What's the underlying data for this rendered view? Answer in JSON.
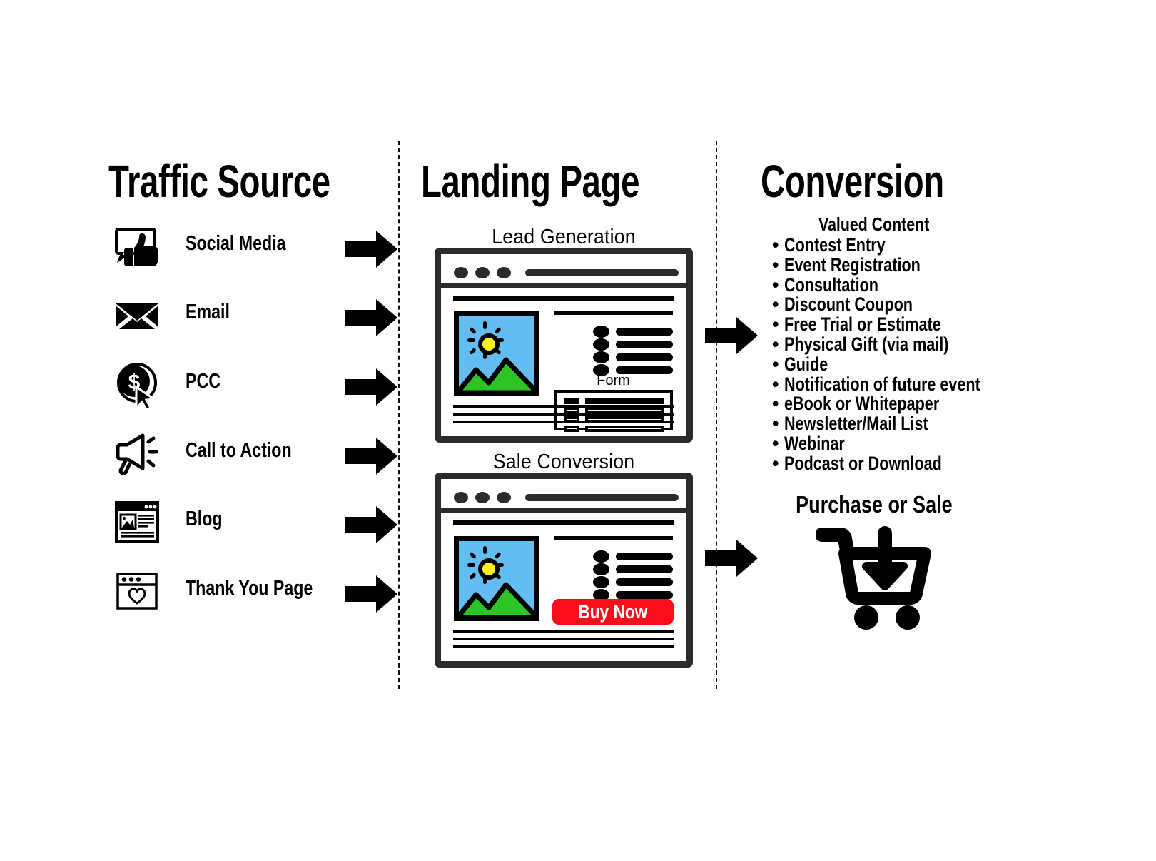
{
  "columns": {
    "traffic": {
      "title": "Traffic Source"
    },
    "landing": {
      "title": "Landing Page"
    },
    "conversion": {
      "title": "Conversion"
    }
  },
  "traffic_sources": [
    {
      "label": "Social Media",
      "icon": "thumbs-up-speech-bubble-icon"
    },
    {
      "label": "Email",
      "icon": "envelope-icon"
    },
    {
      "label": "PCC",
      "icon": "pay-per-click-cursor-icon"
    },
    {
      "label": "Call to Action",
      "icon": "megaphone-icon"
    },
    {
      "label": "Blog",
      "icon": "blog-article-window-icon"
    },
    {
      "label": "Thank You Page",
      "icon": "heart-window-icon"
    }
  ],
  "landing_pages": [
    {
      "caption": "Lead Generation",
      "form_label": "Form",
      "cta": null
    },
    {
      "caption": "Sale Conversion",
      "form_label": null,
      "cta": "Buy Now"
    }
  ],
  "conversion": {
    "valued_content_title": "Valued Content",
    "valued_content_items": [
      "Contest Entry",
      "Event Registration",
      "Consultation",
      "Discount Coupon",
      "Free Trial or Estimate",
      "Physical Gift (via mail)",
      "Guide",
      "Notification of future event",
      "eBook or Whitepaper",
      "Newsletter/Mail List",
      "Webinar",
      "Podcast or Download"
    ],
    "purchase_title": "Purchase or Sale",
    "purchase_icon": "shopping-cart-download-icon"
  },
  "colors": {
    "ink": "#000000",
    "frame": "#2b2b2b",
    "sky": "#63bdf1",
    "grass": "#2ec423",
    "sun": "#fdee21",
    "cta_red": "#fc0d1b",
    "paper": "#ffffff"
  },
  "flow_arrows": {
    "count_source_to_landing": 6,
    "count_landing_to_conversion": 2,
    "glyph": "right-arrow-icon"
  }
}
